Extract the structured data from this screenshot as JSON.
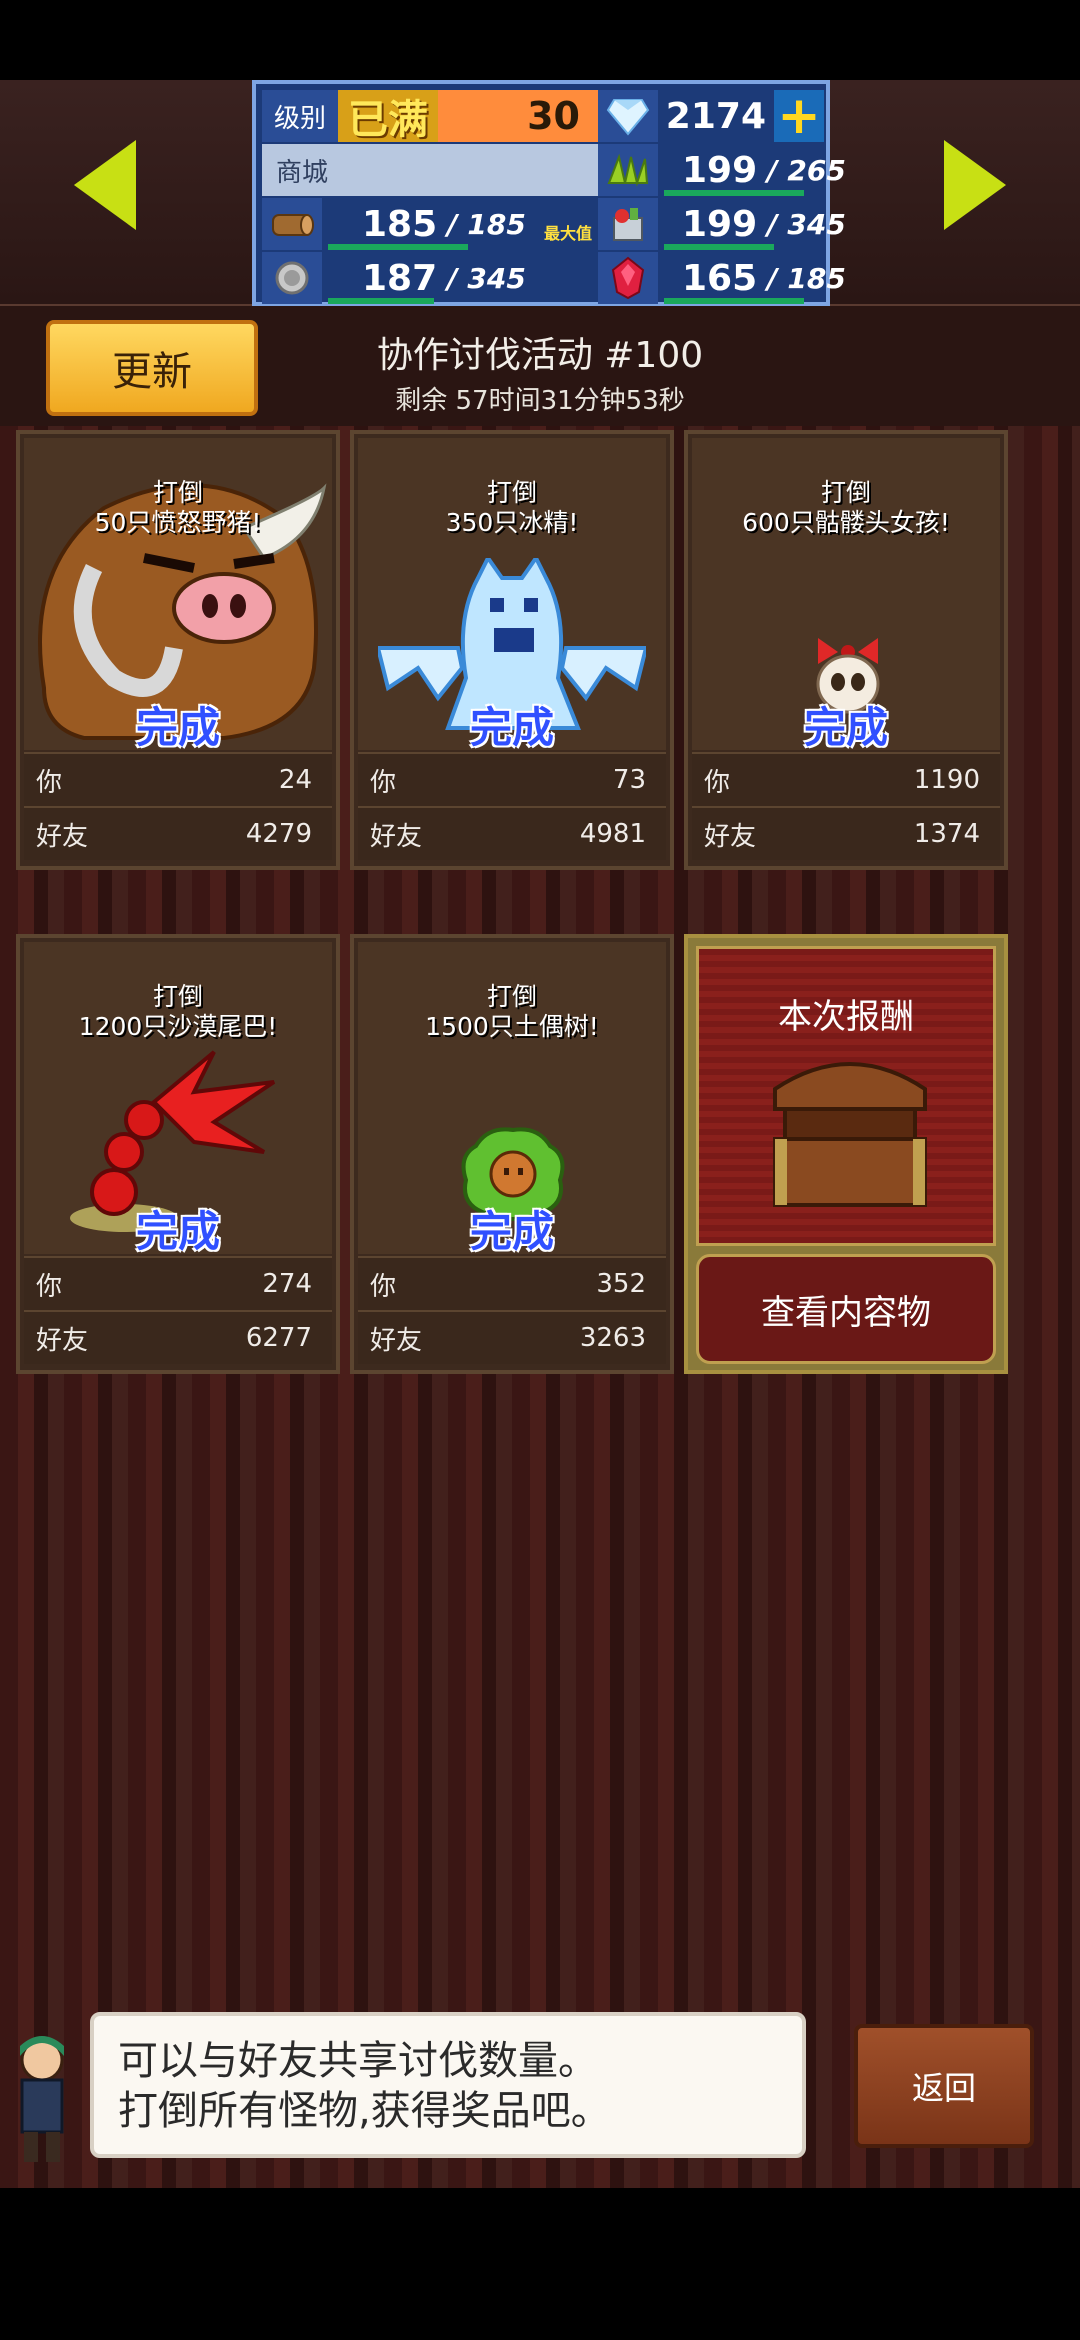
{
  "stats": {
    "level_label": "级别",
    "level_badge": "已满",
    "level_value": "30",
    "gems": "2174",
    "plus_icon": "+",
    "shop_label": "商城",
    "grass": {
      "value": "199",
      "max": "265"
    },
    "wood": {
      "value": "185",
      "max": "185",
      "note": "最大值"
    },
    "food": {
      "value": "199",
      "max": "345"
    },
    "stone": {
      "value": "187",
      "max": "345"
    },
    "ruby": {
      "value": "165",
      "max": "185"
    },
    "bar_color": "#1aa85c"
  },
  "header": {
    "update_button": "更新",
    "event_title": "协作讨伐活动 #100",
    "time_left": "剩余 57时间31分钟53秒"
  },
  "cards": [
    {
      "target": "打倒\n50只愤怒野猪!",
      "status": "完成",
      "you_label": "你",
      "you_value": "24",
      "friend_label": "好友",
      "friend_value": "4279",
      "monster": "boar-icon"
    },
    {
      "target": "打倒\n350只冰精!",
      "status": "完成",
      "you_label": "你",
      "you_value": "73",
      "friend_label": "好友",
      "friend_value": "4981",
      "monster": "ice-spirit-icon"
    },
    {
      "target": "打倒\n600只骷髅头女孩!",
      "status": "完成",
      "you_label": "你",
      "you_value": "1190",
      "friend_label": "好友",
      "friend_value": "1374",
      "monster": "skull-girl-icon"
    },
    {
      "target": "打倒\n1200只沙漠尾巴!",
      "status": "完成",
      "you_label": "你",
      "you_value": "274",
      "friend_label": "好友",
      "friend_value": "6277",
      "monster": "scorpion-tail-icon"
    },
    {
      "target": "打倒\n1500只土偶树!",
      "status": "完成",
      "you_label": "你",
      "you_value": "352",
      "friend_label": "好友",
      "friend_value": "3263",
      "monster": "tree-doll-icon"
    }
  ],
  "reward": {
    "title": "本次报酬",
    "view_button": "查看内容物"
  },
  "footer": {
    "message_line1": "可以与好友共享讨伐数量。",
    "message_line2": "打倒所有怪物,获得奖品吧。",
    "back_button": "返回"
  }
}
